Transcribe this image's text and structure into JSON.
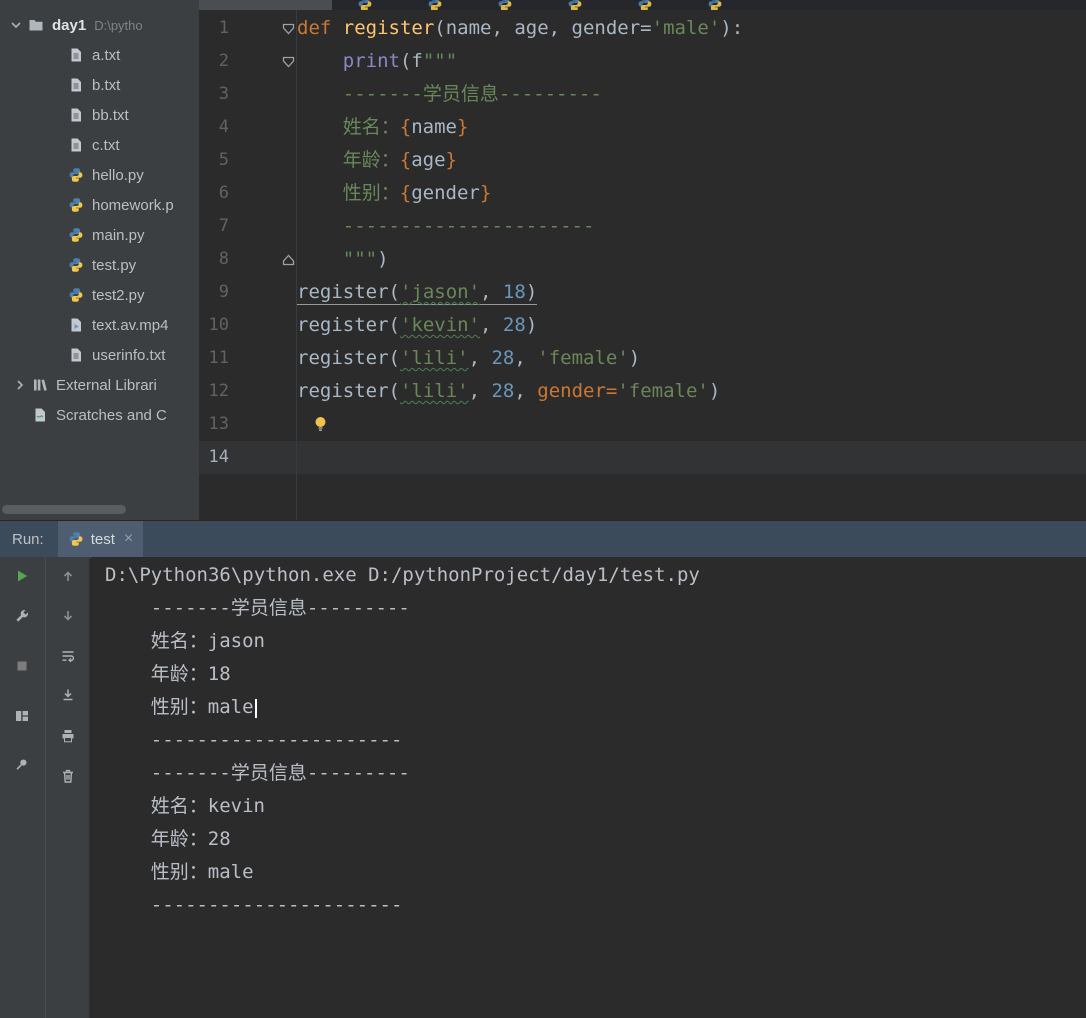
{
  "project_panel": {
    "root": {
      "name": "day1",
      "path": "D:\\pytho"
    },
    "items": [
      {
        "label": "a.txt",
        "icon": "text-file"
      },
      {
        "label": "b.txt",
        "icon": "text-file"
      },
      {
        "label": "bb.txt",
        "icon": "text-file"
      },
      {
        "label": "c.txt",
        "icon": "text-file"
      },
      {
        "label": "hello.py",
        "icon": "python-file"
      },
      {
        "label": "homework.p",
        "icon": "python-file"
      },
      {
        "label": "main.py",
        "icon": "python-file"
      },
      {
        "label": "test.py",
        "icon": "python-file"
      },
      {
        "label": "test2.py",
        "icon": "python-file"
      },
      {
        "label": "text.av.mp4",
        "icon": "media-file"
      },
      {
        "label": "userinfo.txt",
        "icon": "text-file"
      }
    ],
    "nodes": [
      {
        "label": "External Librari",
        "icon": "libraries",
        "chevron": true
      },
      {
        "label": "Scratches and C",
        "icon": "scratches",
        "chevron": false
      }
    ]
  },
  "editor": {
    "lines": [
      {
        "fold": "start",
        "tokens": [
          {
            "t": "def ",
            "c": "kw"
          },
          {
            "t": "register",
            "c": "fn"
          },
          {
            "t": "(name, age, gender=",
            "c": "d"
          },
          {
            "t": "'male'",
            "c": "str"
          },
          {
            "t": "):",
            "c": "d"
          }
        ]
      },
      {
        "fold": "start",
        "tokens": [
          {
            "t": "    ",
            "c": "d"
          },
          {
            "t": "print",
            "c": "bi"
          },
          {
            "t": "(f",
            "c": "d"
          },
          {
            "t": "\"\"\"",
            "c": "str"
          }
        ]
      },
      {
        "tokens": [
          {
            "t": "    -------学员信息---------",
            "c": "str"
          }
        ]
      },
      {
        "tokens": [
          {
            "t": "    姓名：",
            "c": "str"
          },
          {
            "t": "{",
            "c": "br"
          },
          {
            "t": "name",
            "c": "d"
          },
          {
            "t": "}",
            "c": "br"
          }
        ]
      },
      {
        "tokens": [
          {
            "t": "    年龄：",
            "c": "str"
          },
          {
            "t": "{",
            "c": "br"
          },
          {
            "t": "age",
            "c": "d"
          },
          {
            "t": "}",
            "c": "br"
          }
        ]
      },
      {
        "tokens": [
          {
            "t": "    性别：",
            "c": "str"
          },
          {
            "t": "{",
            "c": "br"
          },
          {
            "t": "gender",
            "c": "d"
          },
          {
            "t": "}",
            "c": "br"
          }
        ]
      },
      {
        "tokens": [
          {
            "t": "    ----------------------",
            "c": "str"
          }
        ]
      },
      {
        "fold": "end",
        "tokens": [
          {
            "t": "    \"\"\"",
            "c": "str"
          },
          {
            "t": ")",
            "c": "d"
          }
        ]
      },
      {
        "underline": true,
        "tokens": [
          {
            "t": "register(",
            "c": "d"
          },
          {
            "t": "'jason'",
            "c": "str",
            "w": true
          },
          {
            "t": ", ",
            "c": "d"
          },
          {
            "t": "18",
            "c": "num"
          },
          {
            "t": ")",
            "c": "d"
          }
        ]
      },
      {
        "tokens": [
          {
            "t": "register(",
            "c": "d"
          },
          {
            "t": "'kevin'",
            "c": "str",
            "w": true
          },
          {
            "t": ", ",
            "c": "d"
          },
          {
            "t": "28",
            "c": "num"
          },
          {
            "t": ")",
            "c": "d"
          }
        ]
      },
      {
        "tokens": [
          {
            "t": "register(",
            "c": "d"
          },
          {
            "t": "'lili'",
            "c": "str",
            "w": true
          },
          {
            "t": ", ",
            "c": "d"
          },
          {
            "t": "28",
            "c": "num"
          },
          {
            "t": ", ",
            "c": "d"
          },
          {
            "t": "'female'",
            "c": "str"
          },
          {
            "t": ")",
            "c": "d"
          }
        ]
      },
      {
        "tokens": [
          {
            "t": "register(",
            "c": "d"
          },
          {
            "t": "'lili'",
            "c": "str",
            "w": true
          },
          {
            "t": ", ",
            "c": "d"
          },
          {
            "t": "28",
            "c": "num"
          },
          {
            "t": ", ",
            "c": "d"
          },
          {
            "t": "gender=",
            "c": "arg"
          },
          {
            "t": "'female'",
            "c": "str"
          },
          {
            "t": ")",
            "c": "d"
          }
        ]
      },
      {
        "bulb": true,
        "tokens": []
      },
      {
        "current": true,
        "tokens": []
      }
    ]
  },
  "run_panel": {
    "label": "Run:",
    "tab": {
      "title": "test",
      "close": "×"
    }
  },
  "run_toolbar": {
    "left": [
      "rerun",
      "settings",
      "stop",
      "restore-layout",
      "pin"
    ],
    "right": [
      "up",
      "down",
      "soft-wrap",
      "scroll-to-end",
      "print",
      "clear"
    ]
  },
  "console": {
    "lines": [
      "D:\\Python36\\python.exe D:/pythonProject/day1/test.py",
      "",
      "    -------学员信息---------",
      "    姓名：jason",
      "    年龄：18",
      "    性别：male",
      "    ----------------------",
      "",
      "",
      "    -------学员信息---------",
      "    姓名：kevin",
      "    年龄：28",
      "    性别：male",
      "    ----------------------"
    ],
    "cursor_line_index": 5
  },
  "colors": {
    "editor_bg": "#2B2B2B",
    "panel_bg": "#3C3F41",
    "keyword": "#CC7832",
    "function": "#FFC66E",
    "string": "#6A8759",
    "number": "#6897BB",
    "builtin": "#8888C6",
    "run_header": "#3C4B5C",
    "run_button_green": "#53A653"
  }
}
